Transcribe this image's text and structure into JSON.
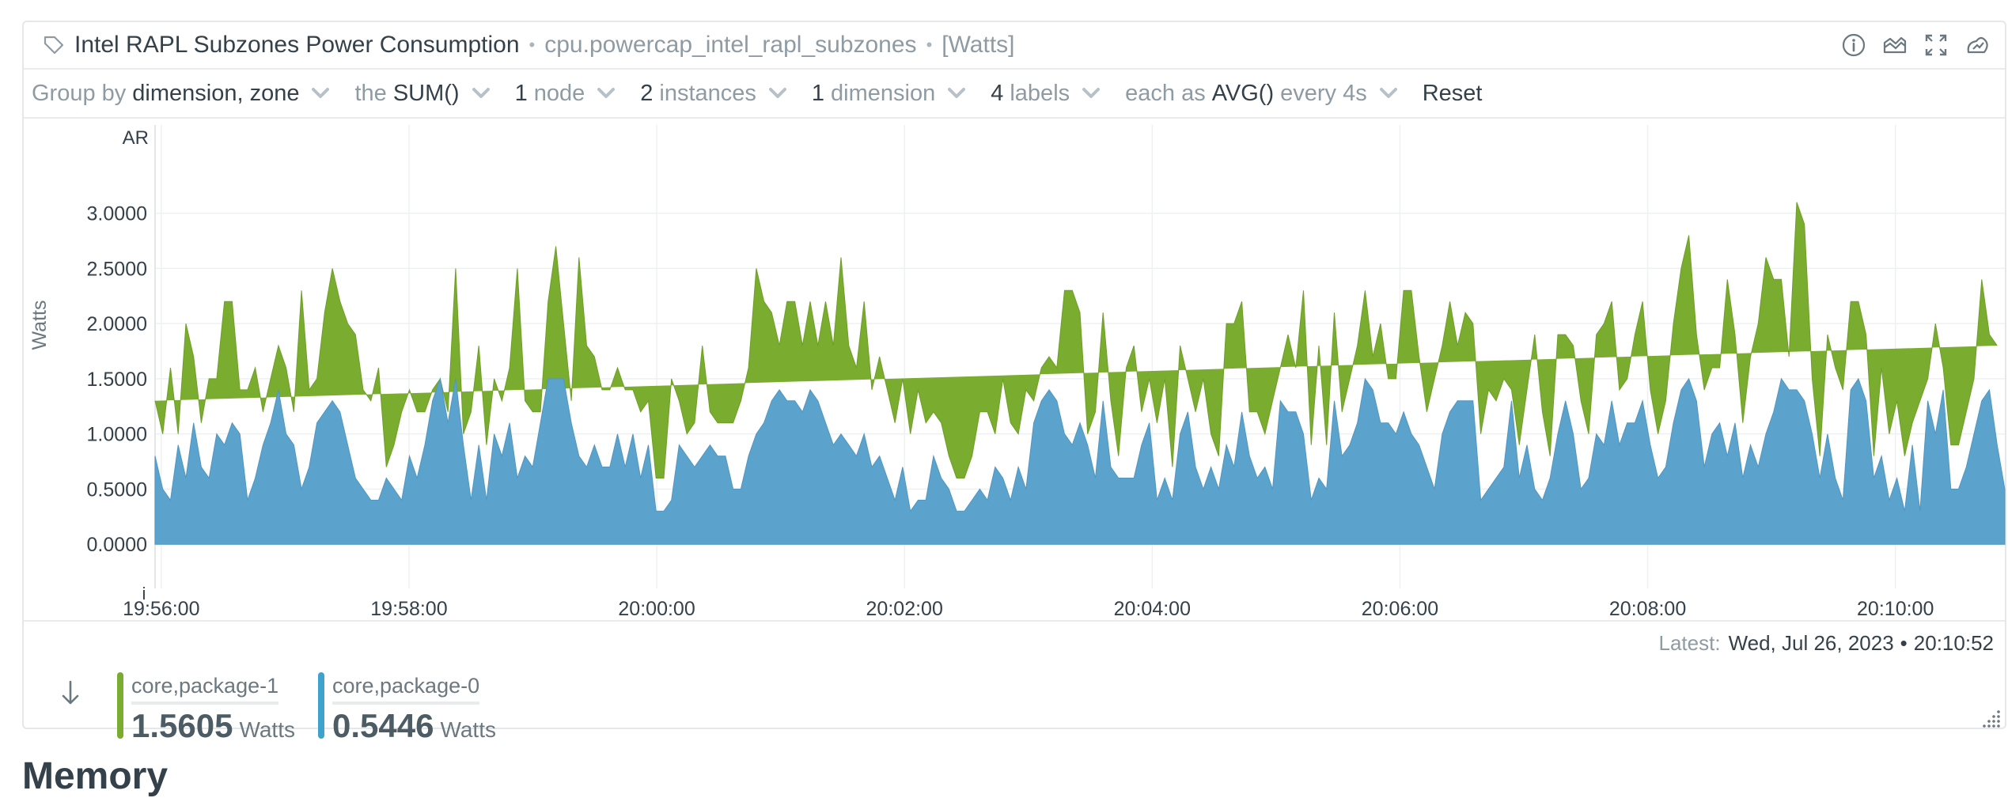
{
  "card": {
    "title": "Intel RAPL Subzones Power Consumption",
    "context": "cpu.powercap_intel_rapl_subzones",
    "units": "[Watts]",
    "separator": "•",
    "actions": [
      "info-icon",
      "chart-type-icon",
      "fullscreen-icon",
      "anomaly-icon"
    ]
  },
  "toolbar": {
    "group_by_label": "Group by",
    "group_by_value": "dimension, zone",
    "agg_prefix": "the",
    "agg_value": "SUM()",
    "nodes_count": "1",
    "nodes_label": "node",
    "instances_count": "2",
    "instances_label": "instances",
    "dimensions_count": "1",
    "dimensions_label": "dimension",
    "labels_count": "4",
    "labels_label": "labels",
    "each_as_label": "each as",
    "time_agg_value": "AVG()",
    "every_label": "every 4s",
    "reset_label": "Reset"
  },
  "chart_data": {
    "type": "area",
    "stacked": true,
    "ylabel": "Watts",
    "corner_top": "AR",
    "corner_bottom": "i",
    "ylim": [
      -0.4,
      3.8
    ],
    "yticks": [
      0,
      0.5,
      1,
      1.5,
      2,
      2.5,
      3
    ],
    "ytick_labels": [
      "0.0000",
      "0.5000",
      "1.0000",
      "1.5000",
      "2.0000",
      "2.5000",
      "3.0000"
    ],
    "xtick_labels": [
      "19:56:00",
      "19:58:00",
      "20:00:00",
      "20:02:00",
      "20:04:00",
      "20:06:00",
      "20:08:00",
      "20:10:00"
    ],
    "xtick_seconds": [
      0,
      120,
      240,
      360,
      480,
      600,
      720,
      840
    ],
    "x_start_seconds": -3,
    "x_end_seconds": 893,
    "grid": true,
    "series": [
      {
        "name": "core,package-0",
        "color": "#5ba3cd",
        "values": [
          0.8,
          0.5,
          0.4,
          0.9,
          0.6,
          1.1,
          0.7,
          0.6,
          1.0,
          0.9,
          1.1,
          1.0,
          0.4,
          0.6,
          0.9,
          1.1,
          1.4,
          1.0,
          0.9,
          0.5,
          0.7,
          1.1,
          1.2,
          1.3,
          1.2,
          0.9,
          0.6,
          0.5,
          0.4,
          0.4,
          0.6,
          0.5,
          0.4,
          0.8,
          0.6,
          0.9,
          1.3,
          1.5,
          1.1,
          1.5,
          0.9,
          0.4,
          0.9,
          0.4,
          1.0,
          0.8,
          1.1,
          0.6,
          0.8,
          0.7,
          1.1,
          1.5,
          1.5,
          1.5,
          1.1,
          0.8,
          0.7,
          0.9,
          0.7,
          0.7,
          1.0,
          0.7,
          1.0,
          0.6,
          0.9,
          0.3,
          0.3,
          0.4,
          0.9,
          0.8,
          0.7,
          0.8,
          0.9,
          0.8,
          0.8,
          0.5,
          0.5,
          0.8,
          1.0,
          1.1,
          1.3,
          1.4,
          1.3,
          1.3,
          1.2,
          1.4,
          1.3,
          1.1,
          0.9,
          1.0,
          0.9,
          0.8,
          1.0,
          0.7,
          0.8,
          0.6,
          0.4,
          0.7,
          0.3,
          0.4,
          0.4,
          0.8,
          0.6,
          0.5,
          0.3,
          0.3,
          0.4,
          0.5,
          0.4,
          0.7,
          0.6,
          0.4,
          0.7,
          0.5,
          1.1,
          1.3,
          1.4,
          1.3,
          1.0,
          0.9,
          1.1,
          0.9,
          0.6,
          1.3,
          0.7,
          0.6,
          0.6,
          0.6,
          0.9,
          1.1,
          0.4,
          0.6,
          0.4,
          1.0,
          1.2,
          0.7,
          0.5,
          0.7,
          0.5,
          0.9,
          0.7,
          1.2,
          0.8,
          0.6,
          0.7,
          0.5,
          1.3,
          1.2,
          1.2,
          1.0,
          0.4,
          0.6,
          0.5,
          1.3,
          0.8,
          0.9,
          1.1,
          1.5,
          1.4,
          1.1,
          1.1,
          1.0,
          1.2,
          1.0,
          0.9,
          0.7,
          0.5,
          1.0,
          1.2,
          1.3,
          1.3,
          1.3,
          0.4,
          0.5,
          0.6,
          0.7,
          1.3,
          0.6,
          0.9,
          0.5,
          0.4,
          0.6,
          1.0,
          1.3,
          1.0,
          0.5,
          0.6,
          1.0,
          0.9,
          1.3,
          0.9,
          1.1,
          1.1,
          1.3,
          0.9,
          0.6,
          0.7,
          1.1,
          1.4,
          1.5,
          1.3,
          0.7,
          1.0,
          1.1,
          0.8,
          1.1,
          0.6,
          0.9,
          0.7,
          1.0,
          1.2,
          1.5,
          1.4,
          1.4,
          1.3,
          1.0,
          0.6,
          1.0,
          0.6,
          0.4,
          1.4,
          1.5,
          1.3,
          0.6,
          0.8,
          0.4,
          0.6,
          0.3,
          0.9,
          0.3,
          1.3,
          1.0,
          1.4,
          0.5,
          0.5,
          0.7,
          1.0,
          1.3,
          1.4,
          0.9,
          0.5
        ]
      },
      {
        "name": "core,package-1",
        "color": "#7aac2f",
        "values": [
          0.5,
          0.5,
          1.2,
          0.1,
          1.4,
          0.6,
          0.4,
          0.9,
          0.5,
          1.3,
          1.1,
          0.4,
          1.0,
          1.0,
          0.3,
          0.4,
          0.4,
          0.6,
          0.3,
          1.8,
          0.7,
          0.4,
          0.9,
          1.2,
          1.0,
          1.1,
          1.3,
          0.9,
          0.9,
          1.2,
          0.1,
          0.4,
          0.8,
          0.6,
          0.6,
          0.3,
          0.1,
          0.0,
          0.1,
          1.0,
          0.1,
          0.8,
          0.9,
          0.5,
          0.5,
          0.5,
          0.5,
          1.9,
          0.5,
          0.5,
          0.1,
          0.7,
          1.2,
          0.5,
          0.2,
          1.8,
          1.1,
          0.8,
          0.7,
          0.7,
          0.6,
          0.7,
          0.4,
          0.6,
          0.4,
          0.3,
          0.3,
          1.1,
          0.4,
          0.2,
          0.4,
          1.0,
          0.3,
          0.3,
          0.3,
          0.6,
          0.8,
          0.8,
          1.5,
          1.1,
          0.8,
          0.4,
          0.9,
          0.9,
          0.6,
          0.8,
          0.5,
          1.1,
          0.9,
          1.6,
          0.9,
          0.8,
          1.2,
          0.7,
          0.9,
          0.8,
          0.7,
          0.8,
          0.7,
          1.0,
          0.7,
          0.4,
          0.5,
          0.3,
          0.3,
          0.3,
          0.4,
          0.7,
          0.8,
          0.3,
          0.9,
          0.7,
          0.3,
          0.9,
          0.2,
          0.3,
          0.3,
          0.3,
          1.3,
          1.4,
          1.0,
          0.1,
          0.6,
          0.8,
          0.6,
          0.2,
          1.0,
          1.2,
          0.3,
          0.4,
          0.7,
          0.9,
          0.3,
          0.8,
          0.3,
          0.5,
          1.0,
          0.3,
          0.3,
          1.1,
          1.3,
          1.0,
          0.4,
          0.6,
          0.3,
          0.8,
          0.3,
          0.7,
          0.4,
          1.3,
          0.5,
          1.2,
          0.4,
          0.8,
          0.4,
          0.6,
          0.7,
          0.8,
          0.3,
          0.9,
          0.4,
          0.5,
          1.1,
          1.3,
          0.8,
          0.5,
          1.0,
          0.8,
          1.0,
          0.5,
          0.8,
          0.7,
          0.6,
          0.9,
          0.7,
          0.8,
          0.1,
          0.3,
          0.5,
          1.4,
          0.8,
          0.2,
          0.9,
          0.6,
          0.8,
          0.8,
          0.4,
          0.9,
          1.1,
          0.9,
          0.5,
          0.4,
          0.8,
          0.9,
          0.5,
          0.4,
          0.6,
          0.9,
          1.1,
          1.3,
          0.6,
          0.7,
          0.6,
          0.5,
          1.6,
          0.8,
          0.5,
          0.8,
          1.3,
          1.6,
          1.2,
          0.9,
          0.3,
          1.7,
          1.6,
          0.5,
          0.2,
          0.9,
          1.0,
          1.0,
          0.8,
          0.7,
          0.6,
          0.2,
          0.8,
          0.6,
          0.7,
          0.5,
          0.2,
          1.0,
          0.2,
          1.0,
          0.2,
          0.4,
          0.4,
          0.5,
          0.5,
          1.1,
          0.5,
          0.9
        ]
      }
    ]
  },
  "footer": {
    "latest_label": "Latest:",
    "latest_date": "Wed, Jul 26, 2023",
    "latest_time": "20:10:52",
    "dot": "•",
    "legend": [
      {
        "name": "core,package-1",
        "value": "1.5605",
        "unit": "Watts",
        "color": "#7aac2f"
      },
      {
        "name": "core,package-0",
        "value": "0.5446",
        "unit": "Watts",
        "color": "#3fa2cc"
      }
    ]
  },
  "next_section": {
    "heading": "Memory"
  }
}
